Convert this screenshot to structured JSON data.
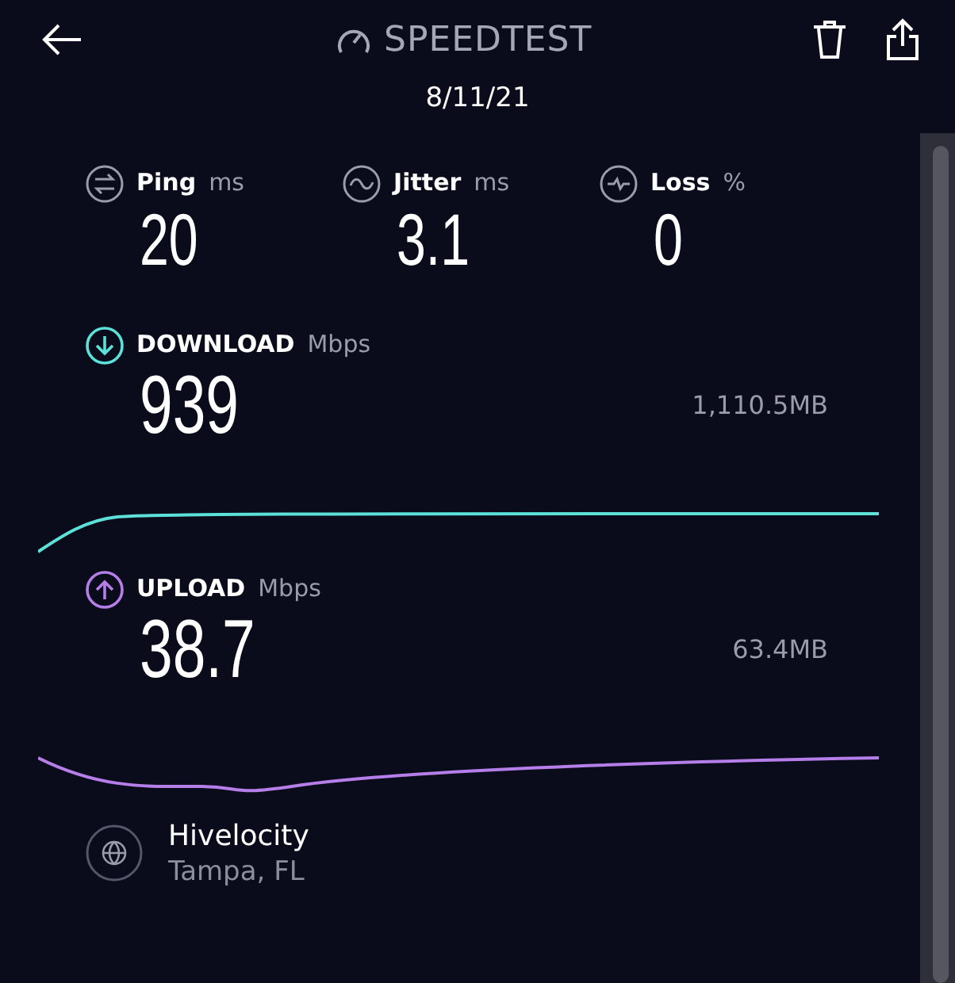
{
  "header": {
    "title": "SPEEDTEST",
    "date": "8/11/21"
  },
  "metrics": [
    {
      "kind": "ping",
      "label": "Ping",
      "unit": "ms",
      "value": "20"
    },
    {
      "kind": "jitter",
      "label": "Jitter",
      "unit": "ms",
      "value": "3.1"
    },
    {
      "kind": "loss",
      "label": "Loss",
      "unit": "%",
      "value": "0"
    }
  ],
  "results": [
    {
      "kind": "download",
      "label": "DOWNLOAD",
      "unit": "Mbps",
      "value": "939",
      "data": "1,110.5MB",
      "color": "#5ce1d8"
    },
    {
      "kind": "upload",
      "label": "UPLOAD",
      "unit": "Mbps",
      "value": "38.7",
      "data": "63.4MB",
      "color": "#b57ee8"
    }
  ],
  "server": {
    "name": "Hivelocity",
    "location": "Tampa, FL"
  }
}
